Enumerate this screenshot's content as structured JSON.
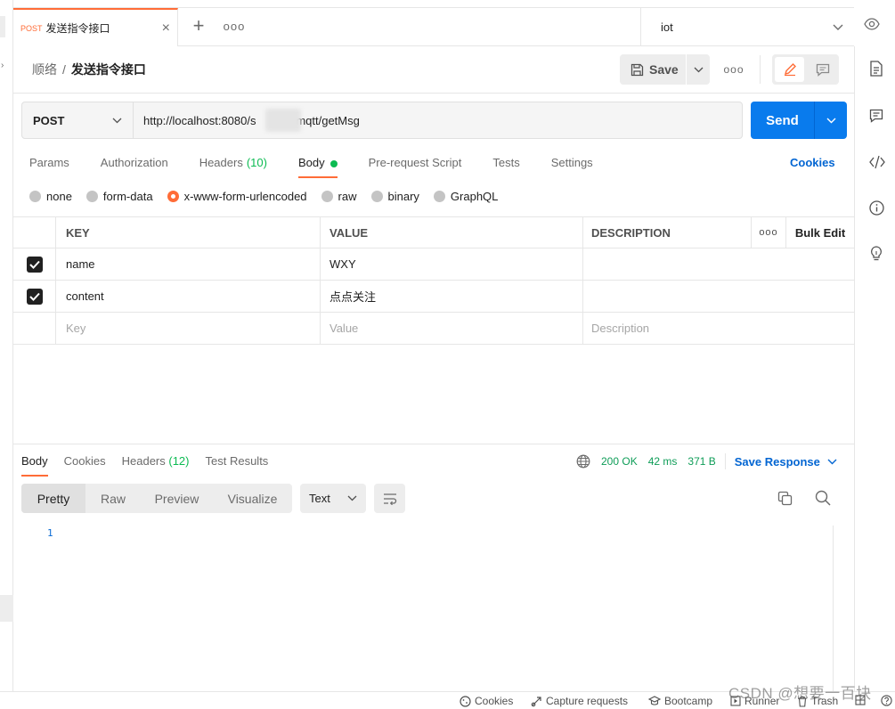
{
  "tab": {
    "method": "POST",
    "name": "发送指令接口"
  },
  "environment": {
    "selected": "iot"
  },
  "breadcrumb": {
    "parent": "顺络",
    "separator": "/",
    "current": "发送指令接口"
  },
  "toolbar": {
    "save_label": "Save"
  },
  "request": {
    "method": "POST",
    "url_prefix": "http://localhost:8080/s",
    "url_suffix": "d/mqtt/getMsg",
    "send_label": "Send"
  },
  "req_tabs": [
    {
      "label": "Params"
    },
    {
      "label": "Authorization"
    },
    {
      "label": "Headers",
      "count": "(10)"
    },
    {
      "label": "Body"
    },
    {
      "label": "Pre-request Script"
    },
    {
      "label": "Tests"
    },
    {
      "label": "Settings"
    }
  ],
  "cookies_link": "Cookies",
  "body_types": [
    "none",
    "form-data",
    "x-www-form-urlencoded",
    "raw",
    "binary",
    "GraphQL"
  ],
  "body_type_selected": "x-www-form-urlencoded",
  "params_table": {
    "headers": {
      "key": "KEY",
      "value": "VALUE",
      "description": "DESCRIPTION",
      "bulk_edit": "Bulk Edit"
    },
    "rows": [
      {
        "checked": true,
        "key": "name",
        "value": "WXY",
        "description": ""
      },
      {
        "checked": true,
        "key": "content",
        "value": "点点关注",
        "description": ""
      }
    ],
    "placeholders": {
      "key": "Key",
      "value": "Value",
      "description": "Description"
    }
  },
  "response": {
    "tabs": [
      {
        "label": "Body"
      },
      {
        "label": "Cookies"
      },
      {
        "label": "Headers",
        "count": "(12)"
      },
      {
        "label": "Test Results"
      }
    ],
    "status": "200 OK",
    "time": "42 ms",
    "size": "371 B",
    "save_label": "Save Response",
    "view_modes": [
      "Pretty",
      "Raw",
      "Preview",
      "Visualize"
    ],
    "format": "Text",
    "line_number": "1"
  },
  "statusbar": {
    "cookies": "Cookies",
    "capture": "Capture requests",
    "bootcamp": "Bootcamp",
    "runner": "Runner",
    "trash": "Trash"
  },
  "watermark": "CSDN @想要一百块",
  "colors": {
    "accent": "#ff6c37",
    "send": "#097bed",
    "success": "#0cbb52",
    "link": "#0265d2"
  }
}
